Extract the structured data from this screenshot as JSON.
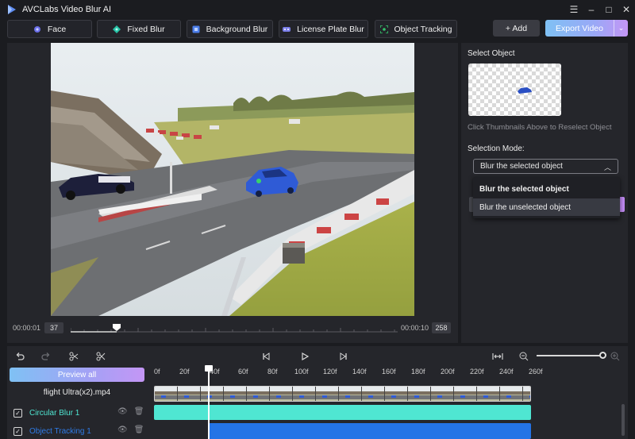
{
  "app": {
    "title": "AVCLabs Video Blur AI"
  },
  "window_controls": {
    "menu": "☰",
    "minimize": "–",
    "maximize": "□",
    "close": "✕"
  },
  "tabs": [
    {
      "label": "Face",
      "icon": "face-icon",
      "color": "#6b6fe8"
    },
    {
      "label": "Fixed Blur",
      "icon": "fixed-blur-icon",
      "color": "#27c2a5"
    },
    {
      "label": "Background Blur",
      "icon": "background-blur-icon",
      "color": "#4c7ee9"
    },
    {
      "label": "License Plate Blur",
      "icon": "license-plate-icon",
      "color": "#7a7ee8"
    },
    {
      "label": "Object Tracking",
      "icon": "object-tracking-icon",
      "color": "#34c46a"
    }
  ],
  "actions": {
    "add": "+ Add",
    "export": "Export Video",
    "export_chevron": "⌄"
  },
  "preview": {
    "current_time": "00:00:01",
    "current_frame": "37",
    "end_time": "00:00:10",
    "total_frames": "258",
    "progress": 0.14
  },
  "panel": {
    "select_object_title": "Select Object",
    "reselect_hint": "Click Thumbnails Above to Reselect Object",
    "selection_mode_label": "Selection Mode:",
    "selection_mode_value": "Blur the selected object",
    "options": [
      "Blur the selected object",
      "Blur the unselected object"
    ]
  },
  "timeline": {
    "preview_all": "Preview all",
    "file_name": "flight Ultra(x2).mp4",
    "layers": [
      {
        "name": "Circular Blur 1",
        "color": "#4fe6d2",
        "checked": true
      },
      {
        "name": "Object Tracking 1",
        "color": "#2f7be6",
        "checked": true
      }
    ],
    "ticks": [
      "0f",
      "20f",
      "40f",
      "60f",
      "80f",
      "100f",
      "120f",
      "140f",
      "160f",
      "180f",
      "200f",
      "220f",
      "240f",
      "260f"
    ],
    "tools": [
      "undo-icon",
      "redo-icon",
      "split-icon",
      "cut-icon",
      "prev-frame-icon",
      "play-icon",
      "next-frame-icon",
      "fit-icon",
      "zoom-out-icon",
      "zoom-in-icon"
    ],
    "zoom_level": 1.0
  },
  "accent_colors": {
    "gradient_start": "#7fc1f4",
    "gradient_end": "#c496f5",
    "blur_track": "#4fe6d2",
    "tracking_track": "#2474e6"
  }
}
